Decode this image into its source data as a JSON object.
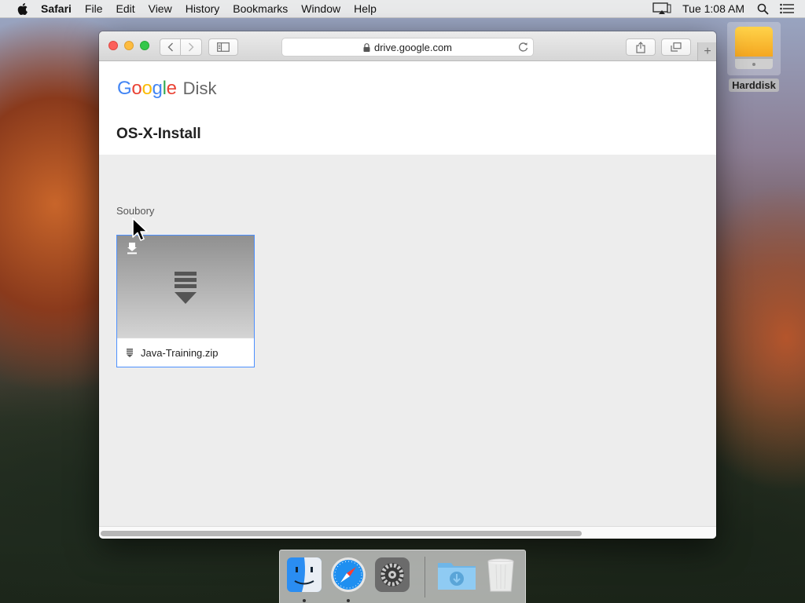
{
  "menubar": {
    "app_name": "Safari",
    "items": [
      "File",
      "Edit",
      "View",
      "History",
      "Bookmarks",
      "Window",
      "Help"
    ],
    "clock": "Tue 1:08 AM"
  },
  "desktop": {
    "disk_label": "Harddisk"
  },
  "browser": {
    "url": "drive.google.com"
  },
  "page": {
    "logo": {
      "letters": [
        {
          "char": "G",
          "color": "#4285f4"
        },
        {
          "char": "o",
          "color": "#ea4335"
        },
        {
          "char": "o",
          "color": "#fbbc05"
        },
        {
          "char": "g",
          "color": "#4285f4"
        },
        {
          "char": "l",
          "color": "#34a853"
        },
        {
          "char": "e",
          "color": "#ea4335"
        }
      ],
      "product": "Disk"
    },
    "folder_title": "OS-X-Install",
    "section_label": "Soubory",
    "file": {
      "name": "Java-Training.zip"
    }
  },
  "colors": {
    "accent_border": "#4d90fe"
  },
  "dock": {
    "items": [
      "finder-icon",
      "safari-icon",
      "system-preferences-icon",
      "downloads-folder-icon",
      "trash-icon"
    ]
  }
}
